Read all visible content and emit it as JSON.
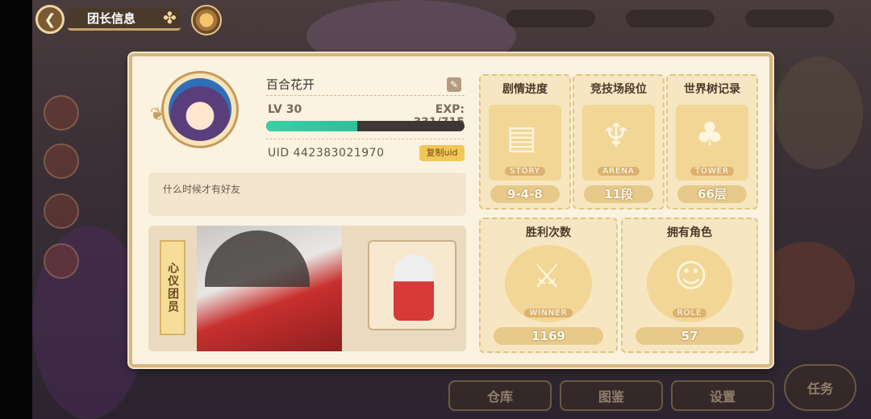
{
  "header": {
    "title": "团长信息",
    "back_icon": "back-arrow-icon",
    "clover_icon": "clover-icon"
  },
  "profile": {
    "name": "百合花开",
    "level": "LV 30",
    "exp": "EXP: 331/715",
    "exp_progress": 0.46,
    "uid": "UID 442383021970",
    "copy_uid_label": "复制uid",
    "signature": "什么时候才有好友"
  },
  "favorite": {
    "label": "心仪团员"
  },
  "stats": {
    "story": {
      "title": "剧情进度",
      "tag": "STORY",
      "value": "9-4-8"
    },
    "arena": {
      "title": "竞技场段位",
      "tag": "ARENA",
      "value": "11段"
    },
    "tower": {
      "title": "世界树记录",
      "tag": "TOWER",
      "value": "66层"
    },
    "wins": {
      "title": "胜利次数",
      "tag": "WINNER",
      "value": "1169"
    },
    "roles": {
      "title": "拥有角色",
      "tag": "ROLE",
      "value": "57"
    }
  },
  "background": {
    "bottom_buttons": [
      "仓库",
      "图鉴",
      "设置",
      "任务"
    ]
  },
  "colors": {
    "panel_bg": "#fbf3e0",
    "accent_gold": "#d8b67f",
    "exp_fill": "#3ad0a5"
  }
}
